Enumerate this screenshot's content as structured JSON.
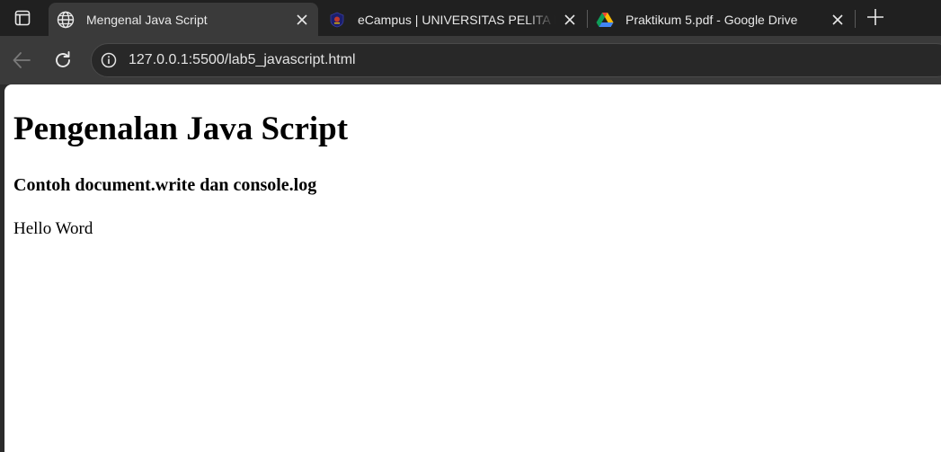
{
  "browser": {
    "tabs": [
      {
        "title": "Mengenal Java Script",
        "favicon": "globe-icon",
        "active": true
      },
      {
        "title": "eCampus | UNIVERSITAS PELITA BANGSA",
        "favicon": "ecampus-logo-icon",
        "active": false
      },
      {
        "title": "Praktikum 5.pdf - Google Drive",
        "favicon": "google-drive-icon",
        "active": false
      }
    ],
    "address_bar": {
      "url": "127.0.0.1:5500/lab5_javascript.html"
    },
    "colors": {
      "tabstrip_bg": "#202020",
      "toolbar_bg": "#3a3a3a",
      "page_bg": "#ffffff"
    }
  },
  "page": {
    "heading": "Pengenalan Java Script",
    "subheading": "Contoh document.write dan console.log",
    "output_text": "Hello Word"
  }
}
